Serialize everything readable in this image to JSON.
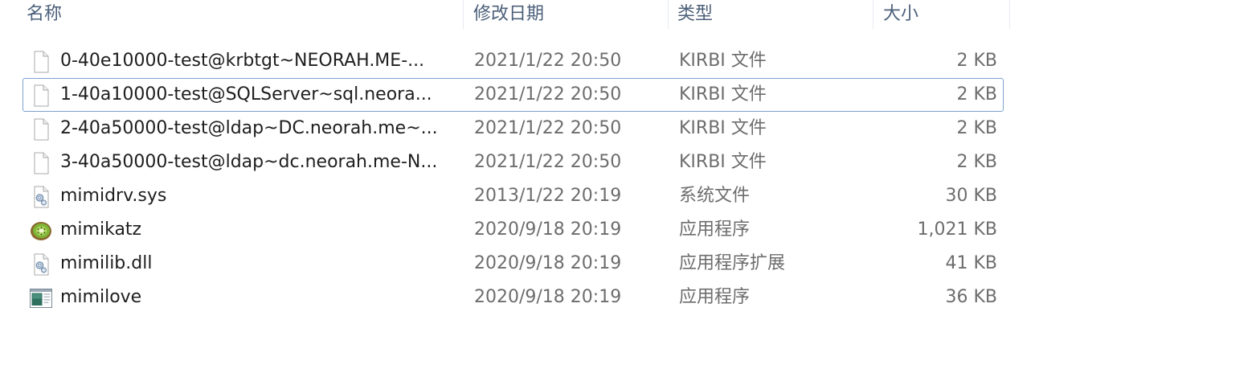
{
  "columns": {
    "name": "名称",
    "date": "修改日期",
    "type": "类型",
    "size": "大小"
  },
  "files": [
    {
      "name": "0-40e10000-test@krbtgt~NEORAH.ME-...",
      "date": "2021/1/22 20:50",
      "type": "KIRBI 文件",
      "size": "2 KB",
      "icon": "blank-file-icon"
    },
    {
      "name": "1-40a10000-test@SQLServer~sql.neora...",
      "date": "2021/1/22 20:50",
      "type": "KIRBI 文件",
      "size": "2 KB",
      "icon": "blank-file-icon",
      "focused": true
    },
    {
      "name": "2-40a50000-test@ldap~DC.neorah.me~...",
      "date": "2021/1/22 20:50",
      "type": "KIRBI 文件",
      "size": "2 KB",
      "icon": "blank-file-icon"
    },
    {
      "name": "3-40a50000-test@ldap~dc.neorah.me-N...",
      "date": "2021/1/22 20:50",
      "type": "KIRBI 文件",
      "size": "2 KB",
      "icon": "blank-file-icon"
    },
    {
      "name": "mimidrv.sys",
      "date": "2013/1/22 20:19",
      "type": "系统文件",
      "size": "30 KB",
      "icon": "system-file-icon"
    },
    {
      "name": "mimikatz",
      "date": "2020/9/18 20:19",
      "type": "应用程序",
      "size": "1,021 KB",
      "icon": "kiwi-app-icon"
    },
    {
      "name": "mimilib.dll",
      "date": "2020/9/18 20:19",
      "type": "应用程序扩展",
      "size": "41 KB",
      "icon": "system-file-icon"
    },
    {
      "name": "mimilove",
      "date": "2020/9/18 20:19",
      "type": "应用程序",
      "size": "36 KB",
      "icon": "application-window-icon"
    }
  ]
}
